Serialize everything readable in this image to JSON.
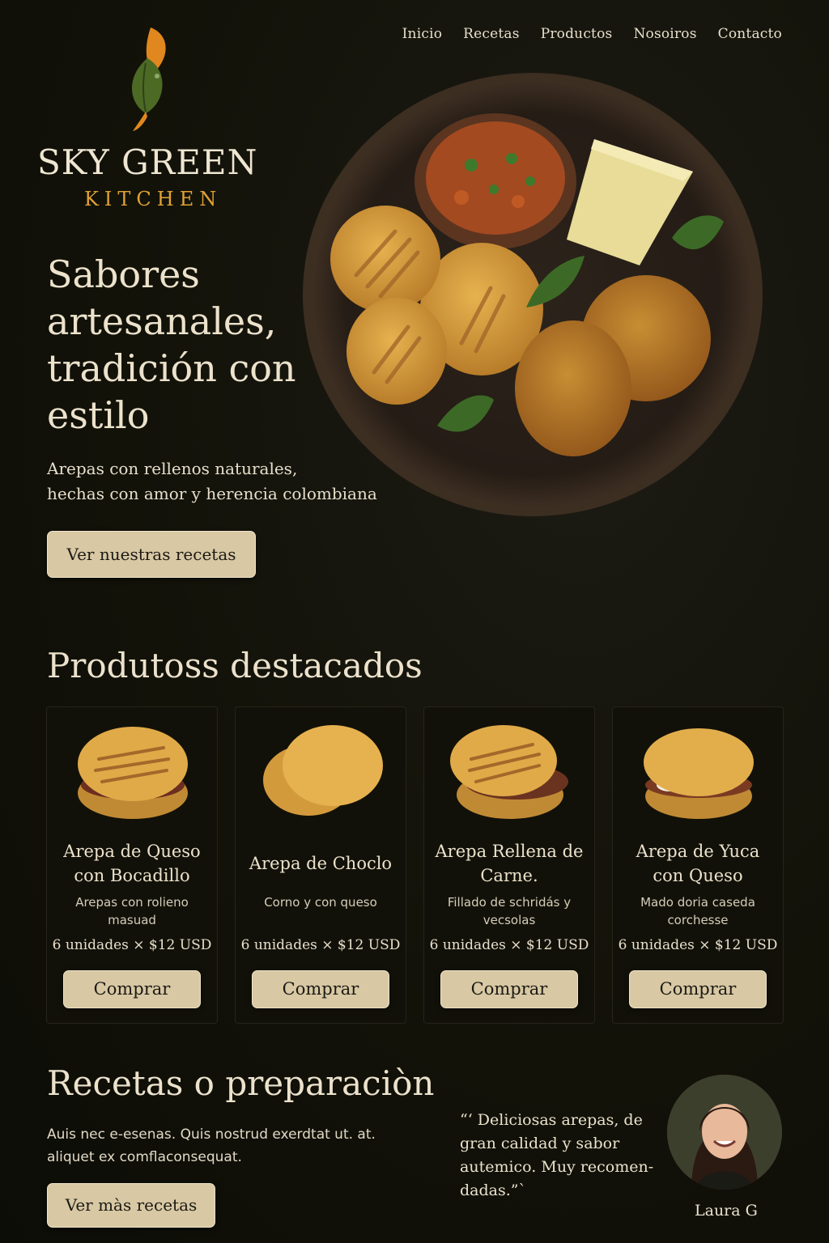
{
  "brand": {
    "name": "SKY GREEN",
    "subtitle": "KITCHEN"
  },
  "nav": {
    "items": [
      "Inicio",
      "Recetas",
      "Productos",
      "Nosoiros",
      "Contacto"
    ]
  },
  "hero": {
    "title": "Sabores artesanales, tradición con estilo",
    "subtitle_line1": "Arepas con rellenos naturales,",
    "subtitle_line2": "hechas con amor y herencia colombiana",
    "cta": "Ver nuestras recetas"
  },
  "products": {
    "title": "Produtoss destacados",
    "items": [
      {
        "name": "Arepa de Queso con Bocadillo",
        "desc": "Arepas con rolieno masuad",
        "price": "6 unidades × $12 USD",
        "button": "Comprar"
      },
      {
        "name": "Arepa de Choclo",
        "desc": "Corno y con queso",
        "price": "6 unidades × $12 USD",
        "button": "Comprar"
      },
      {
        "name": "Arepa Rellena de Carne.",
        "desc": "Fillado de schridás y vecsolas",
        "price": "6 unidades × $12 USD",
        "button": "Comprar"
      },
      {
        "name": "Arepa de Yuca con Queso",
        "desc": "Mado doria caseda corchesse",
        "price": "6 unidades × $12 USD",
        "button": "Comprar"
      }
    ]
  },
  "recipes": {
    "title": "Recetas o preparaciòn",
    "text": "Auis nec e-esenas. Quis nostrud exerdtat ut. at. aliquet ex comflaconsequat.",
    "cta": "Ver màs recetas"
  },
  "testimonial": {
    "quote": "“‘ Deliciosas arepas, de gran calidad y sabor autemico. Muy recomen-dadas.”`",
    "author": "Laura G"
  },
  "colors": {
    "background": "#121209",
    "accent": "#e0a233",
    "button": "#d8c8a4",
    "text": "#ece2cc"
  }
}
